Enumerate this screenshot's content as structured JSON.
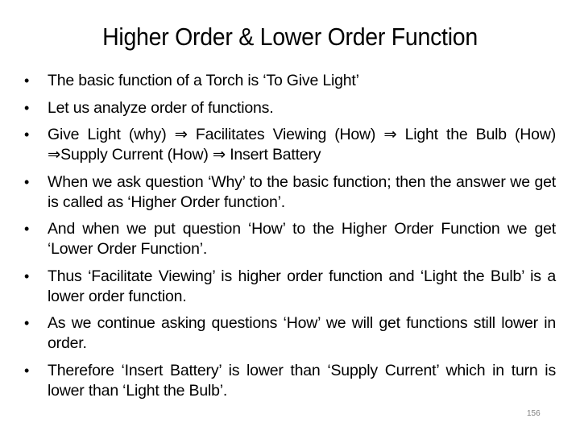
{
  "slide": {
    "title": "Higher Order & Lower Order Function",
    "bullet_symbol": "•",
    "bullets": [
      "The basic function of a Torch is ‘To Give Light’",
      "Let us analyze order of functions.",
      "Give Light (why) ⇒ Facilitates Viewing (How) ⇒ Light the Bulb (How) ⇒Supply Current (How) ⇒ Insert Battery",
      "When we ask question ‘Why’ to the basic function; then the answer we get is called as ‘Higher Order function’.",
      "And when we put question ‘How’ to the Higher Order Function we get ‘Lower Order Function’.",
      "Thus ‘Facilitate Viewing’ is  higher order function and ‘Light the Bulb’ is a lower order function.",
      "As we continue asking questions ‘How’ we will get functions still lower in order.",
      "Therefore ‘Insert Battery’ is lower than ‘Supply Current’ which in turn is lower than ‘Light the Bulb’."
    ],
    "page_number": "156"
  }
}
